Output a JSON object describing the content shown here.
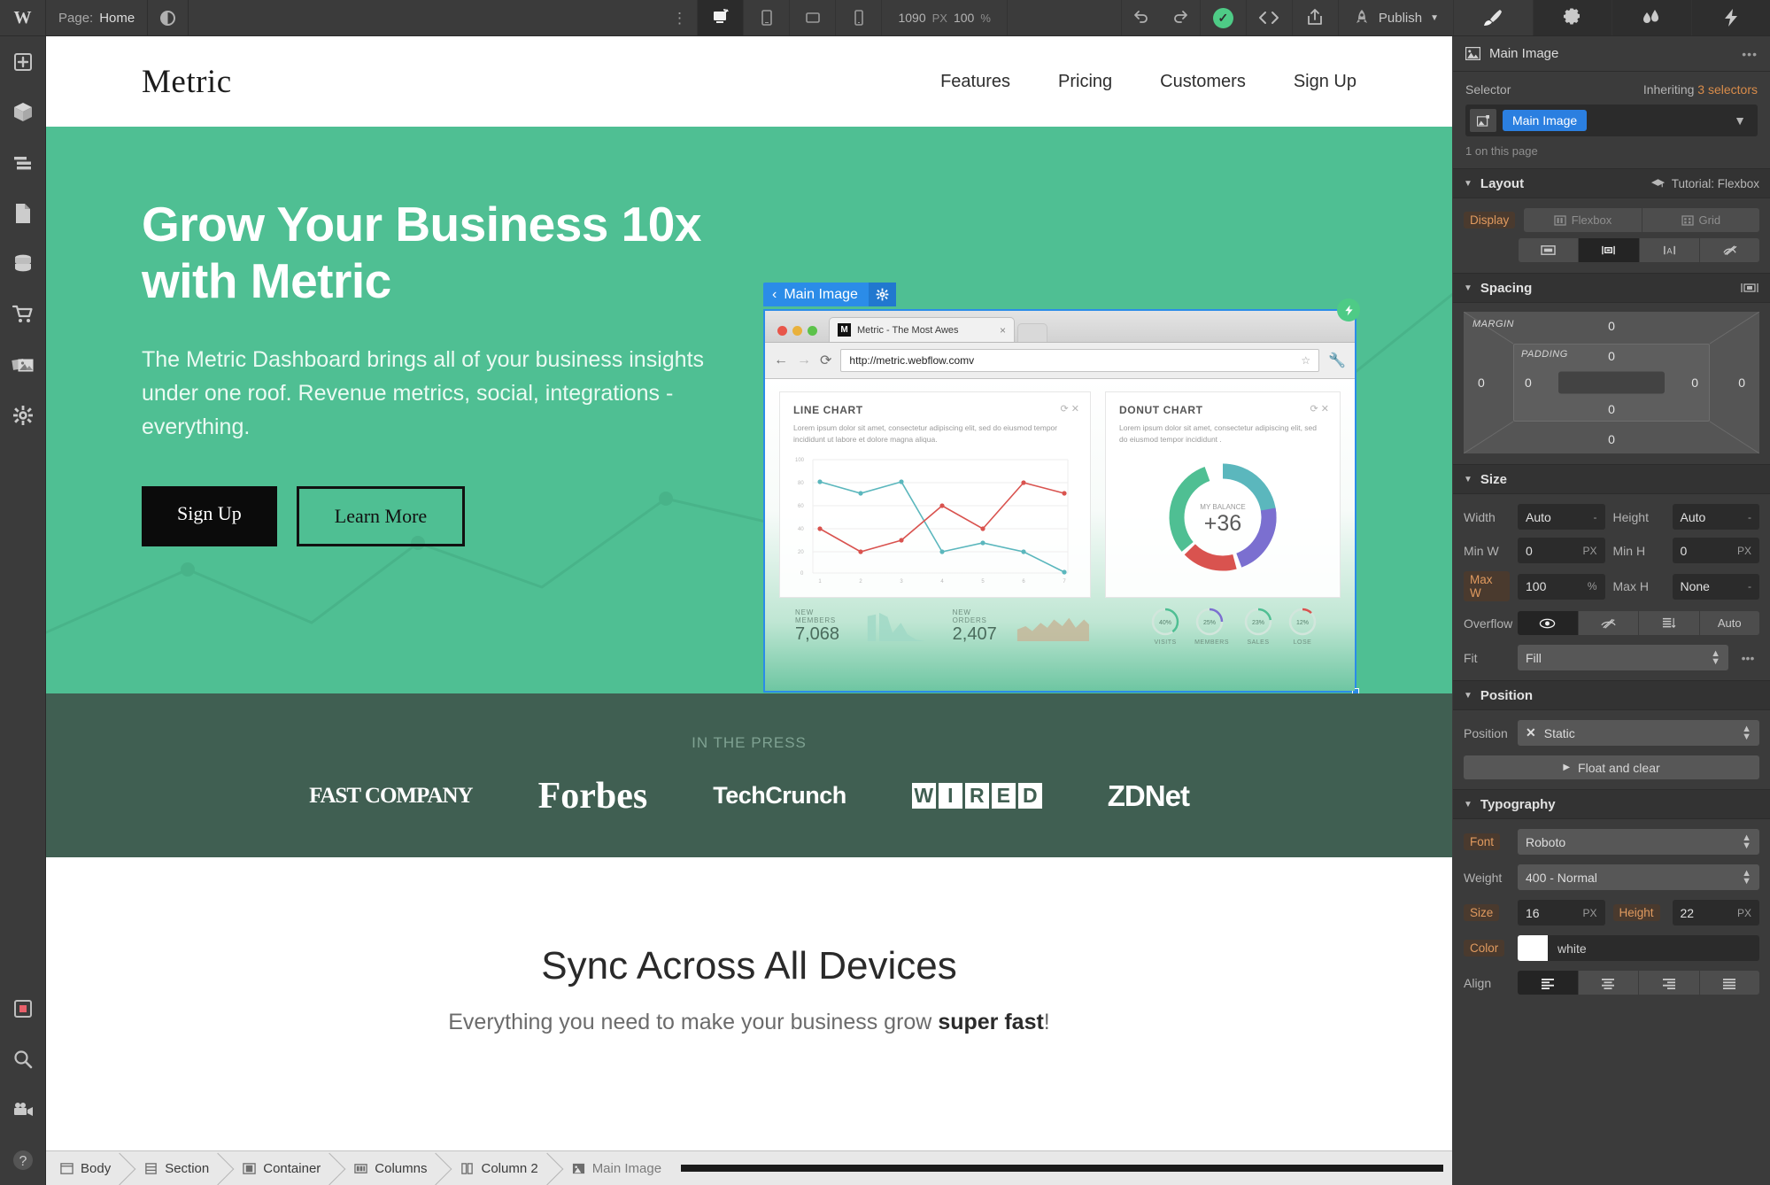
{
  "topbar": {
    "page_label": "Page:",
    "page_name": "Home",
    "viewports": [
      "desktop-viewport",
      "tablet-viewport",
      "mobile-landscape-viewport",
      "mobile-portrait-viewport"
    ],
    "canvas_width": "1090",
    "canvas_width_unit": "PX",
    "zoom_value": "100",
    "zoom_unit": "%",
    "undo_icon": "undo-icon",
    "redo_icon": "redo-icon",
    "status_icon": "saved-check-icon",
    "code_icon": "code-embed-icon",
    "share_icon": "share-icon",
    "publish_icon": "rocket-icon",
    "publish_label": "Publish"
  },
  "right_tabs": [
    {
      "name": "style-panel-tab",
      "icon": "paintbrush-icon",
      "active": true
    },
    {
      "name": "settings-panel-tab",
      "icon": "gear-icon",
      "active": false
    },
    {
      "name": "interactions-panel-tab",
      "icon": "water-drops-icon",
      "active": false
    },
    {
      "name": "effects-panel-tab",
      "icon": "lightning-bolt-icon",
      "active": false
    }
  ],
  "leftbar": {
    "items": [
      {
        "name": "add-elements",
        "icon": "plus-icon"
      },
      {
        "name": "symbols",
        "icon": "cube-icon"
      },
      {
        "name": "navigator",
        "icon": "layers-icon"
      },
      {
        "name": "pages",
        "icon": "page-icon"
      },
      {
        "name": "cms",
        "icon": "database-icon"
      },
      {
        "name": "ecommerce",
        "icon": "shopping-cart-icon"
      },
      {
        "name": "assets",
        "icon": "images-icon"
      },
      {
        "name": "site-settings",
        "icon": "gear-icon"
      }
    ],
    "bottom_items": [
      {
        "name": "audit",
        "icon": "red-square-icon"
      },
      {
        "name": "search",
        "icon": "magnifier-icon"
      },
      {
        "name": "video-tutorials",
        "icon": "video-camera-icon"
      },
      {
        "name": "help",
        "icon": "question-mark-icon"
      }
    ]
  },
  "site": {
    "logo": "Metric",
    "nav_links": [
      "Features",
      "Pricing",
      "Customers",
      "Sign Up"
    ],
    "hero": {
      "heading": "Grow Your Business 10x with Metric",
      "paragraph": "The Metric Dashboard brings all of your business insights under one roof. Revenue metrics, social, integrations - everything.",
      "primary_button": "Sign Up",
      "secondary_button": "Learn More",
      "background_color": "#4fbf93"
    },
    "selection": {
      "label": "Main Image",
      "back_icon": "chevron-left-icon",
      "gear_icon": "gear-icon",
      "bolt_icon": "lightning-bolt-icon"
    },
    "browser_mock": {
      "tab_title": "Metric - The Most Awes",
      "favicon_letter": "M",
      "url": "http://metric.webflow.comv",
      "back_icon": "arrow-left-icon",
      "forward_icon": "arrow-right-icon",
      "reload_icon": "reload-icon",
      "star_icon": "star-icon",
      "wrench_icon": "wrench-icon",
      "line_card": {
        "title": "LINE CHART",
        "description": "Lorem ipsum dolor sit amet, consectetur adipiscing elit, sed do eiusmod tempor incididunt ut labore et dolore magna aliqua."
      },
      "donut_card": {
        "title": "DONUT CHART",
        "description": "Lorem ipsum dolor sit amet, consectetur adipiscing elit, sed do eiusmod tempor incididunt .",
        "center_value": "+36",
        "center_label": "MY BALANCE"
      },
      "stats": [
        {
          "key": "NEW MEMBERS",
          "value": "7,068"
        },
        {
          "key": "NEW ORDERS",
          "value": "2,407"
        }
      ],
      "mini_donuts": [
        {
          "value": "40%",
          "label": "VISITS"
        },
        {
          "value": "25%",
          "label": "MEMBERS"
        },
        {
          "value": "23%",
          "label": "SALES"
        },
        {
          "value": "12%",
          "label": "LOSE"
        }
      ]
    },
    "press": {
      "kicker": "IN THE PRESS",
      "logos": [
        "FAST COMPANY",
        "Forbes",
        "TechCrunch",
        "WIRED",
        "ZDNet"
      ]
    },
    "sync": {
      "heading": "Sync Across All Devices",
      "paragraph_prefix": "Everything you need to make your business grow ",
      "paragraph_bold": "super fast",
      "paragraph_suffix": "!"
    }
  },
  "chart_data": {
    "type": "line",
    "title": "LINE CHART",
    "x": [
      1,
      2,
      3,
      4,
      5,
      6,
      7
    ],
    "xlabel": "",
    "ylabel": "",
    "ylim": [
      0,
      100
    ],
    "yticks": [
      0,
      20,
      40,
      60,
      80,
      100
    ],
    "grid": true,
    "legend": "none",
    "series": [
      {
        "name": "teal-series",
        "color": "#5bb7bd",
        "values": [
          81,
          71,
          81,
          20,
          28,
          20,
          1
        ]
      },
      {
        "name": "red-series",
        "color": "#d9534f",
        "values": [
          40,
          20,
          30,
          60,
          40,
          80,
          70
        ]
      }
    ]
  },
  "style_panel": {
    "element_name": "Main Image",
    "element_icon": "image-icon",
    "more_icon": "ellipsis-icon",
    "selector_label": "Selector",
    "inheriting_prefix": "Inheriting",
    "inheriting_count": "3 selectors",
    "selector_chip": "Main Image",
    "selector_icon": "image-icon",
    "selector_caret": "chevron-down-icon",
    "usage_hint": "1 on this page",
    "layout": {
      "title": "Layout",
      "tutorial_icon": "graduation-cap-icon",
      "tutorial_label": "Tutorial: Flexbox",
      "display_label": "Display",
      "flexbox_label": "Flexbox",
      "grid_label": "Grid",
      "modes": [
        "block-display",
        "inline-block-display",
        "inline-display",
        "none-display"
      ],
      "active_mode_index": 1
    },
    "spacing": {
      "title": "Spacing",
      "reset_icon": "spacing-reset-icon",
      "margin_label": "MARGIN",
      "padding_label": "PADDING",
      "margin": {
        "top": "0",
        "right": "0",
        "bottom": "0",
        "left": "0"
      },
      "padding": {
        "top": "0",
        "right": "0",
        "bottom": "0",
        "left": "0"
      }
    },
    "size": {
      "title": "Size",
      "width_label": "Width",
      "width_value": "Auto",
      "width_unit": "-",
      "height_label": "Height",
      "height_value": "Auto",
      "height_unit": "-",
      "minw_label": "Min W",
      "minw_value": "0",
      "minw_unit": "PX",
      "minh_label": "Min H",
      "minh_value": "0",
      "minh_unit": "PX",
      "maxw_label": "Max W",
      "maxw_value": "100",
      "maxw_unit": "%",
      "maxh_label": "Max H",
      "maxh_value": "None",
      "maxh_unit": "-",
      "overflow_label": "Overflow",
      "overflow_options": [
        "visible-eye-icon",
        "hidden-eye-slash-icon",
        "scroll-icon",
        "Auto"
      ],
      "overflow_active_index": 0,
      "fit_label": "Fit",
      "fit_value": "Fill",
      "fit_more_icon": "ellipsis-icon"
    },
    "position": {
      "title": "Position",
      "label": "Position",
      "value": "Static",
      "value_icon": "x-icon",
      "float_label": "Float and clear",
      "float_caret": "chevron-right-icon"
    },
    "typography": {
      "title": "Typography",
      "font_label": "Font",
      "font_value": "Roboto",
      "weight_label": "Weight",
      "weight_value": "400 - Normal",
      "size_label": "Size",
      "size_value": "16",
      "size_unit": "PX",
      "height_label": "Height",
      "height_value": "22",
      "height_unit": "PX",
      "color_label": "Color",
      "color_value": "white",
      "color_hex": "#ffffff",
      "align_label": "Align",
      "align_options": [
        "align-left",
        "align-center",
        "align-right",
        "align-justify"
      ],
      "align_active_index": 0
    }
  },
  "breadcrumb": [
    {
      "label": "Body",
      "icon": "body-icon"
    },
    {
      "label": "Section",
      "icon": "section-icon"
    },
    {
      "label": "Container",
      "icon": "container-icon"
    },
    {
      "label": "Columns",
      "icon": "columns-icon"
    },
    {
      "label": "Column 2",
      "icon": "column-icon"
    },
    {
      "label": "Main Image",
      "icon": "image-icon"
    }
  ]
}
